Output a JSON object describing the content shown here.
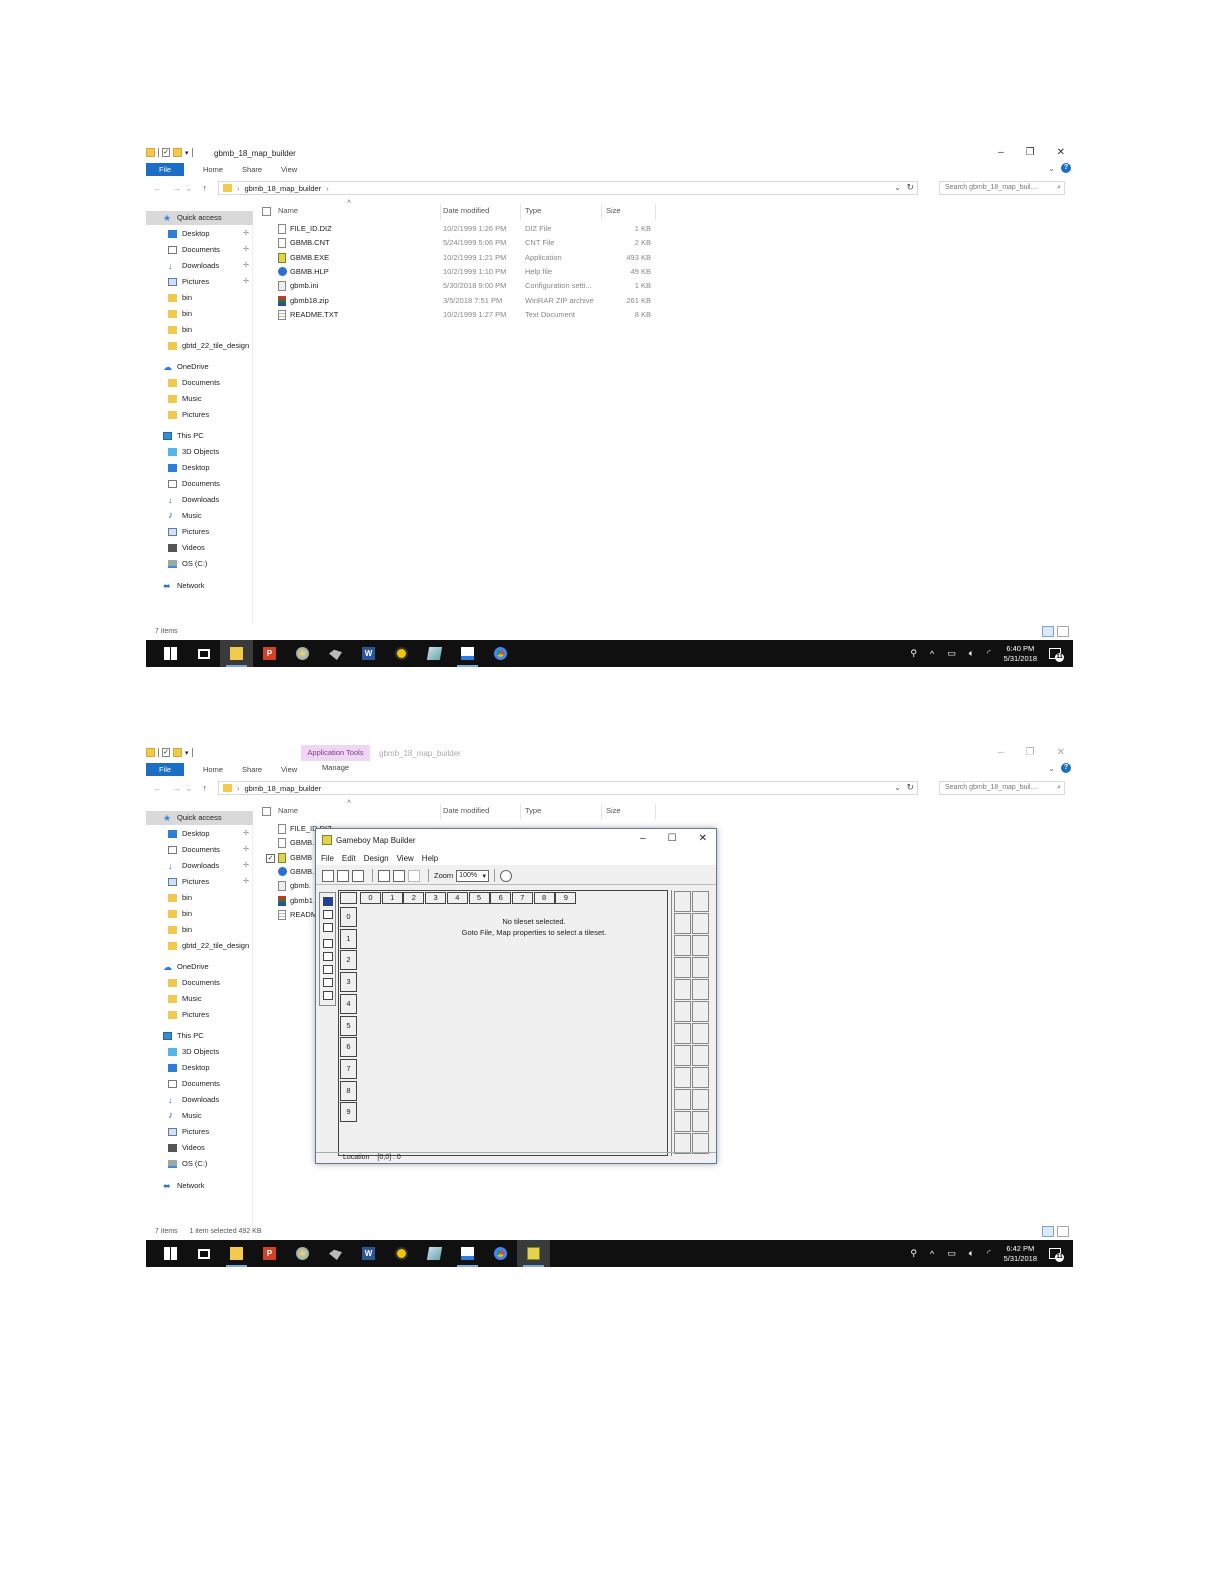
{
  "explorer": {
    "folder_name": "gbmb_18_map_builder",
    "tabs": {
      "file": "File",
      "home": "Home",
      "share": "Share",
      "view": "View"
    },
    "app_tools": {
      "label": "Application Tools",
      "manage": "Manage"
    },
    "search_placeholder": "Search gbmb_18_map_buil...",
    "columns": {
      "name": "Name",
      "date": "Date modified",
      "type": "Type",
      "size": "Size"
    },
    "files": [
      {
        "name": "FILE_ID.DIZ",
        "date": "10/2/1999 1:26 PM",
        "type": "DIZ File",
        "size": "1 KB",
        "icon": "file-icon"
      },
      {
        "name": "GBMB.CNT",
        "date": "5/24/1999 5:06 PM",
        "type": "CNT File",
        "size": "2 KB",
        "icon": "file-icon"
      },
      {
        "name": "GBMB.EXE",
        "date": "10/2/1999 1:21 PM",
        "type": "Application",
        "size": "493 KB",
        "icon": "app-icon"
      },
      {
        "name": "GBMB.HLP",
        "date": "10/2/1999 1:10 PM",
        "type": "Help file",
        "size": "49 KB",
        "icon": "help-icon"
      },
      {
        "name": "gbmb.ini",
        "date": "5/30/2018 9:00 PM",
        "type": "Configuration setti...",
        "size": "1 KB",
        "icon": "config-icon"
      },
      {
        "name": "gbmb18.zip",
        "date": "3/5/2018 7:51 PM",
        "type": "WinRAR ZIP archive",
        "size": "261 KB",
        "icon": "zip-icon"
      },
      {
        "name": "README.TXT",
        "date": "10/2/1999 1:27 PM",
        "type": "Text Document",
        "size": "8 KB",
        "icon": "text-icon"
      }
    ],
    "files_partial": [
      "FILE_ID.DIZ",
      "GBMB.",
      "GBMB",
      "GBMB.",
      "gbmb.",
      "gbmb1",
      "READM"
    ],
    "nav": [
      {
        "label": "Quick access",
        "icon": "star-icon",
        "kind": "header",
        "sel": true
      },
      {
        "label": "Desktop",
        "icon": "desktop-icon",
        "pin": true
      },
      {
        "label": "Documents",
        "icon": "documents-icon",
        "pin": true
      },
      {
        "label": "Downloads",
        "icon": "downloads-icon",
        "pin": true
      },
      {
        "label": "Pictures",
        "icon": "pictures-icon",
        "pin": true
      },
      {
        "label": "bin",
        "icon": "folder-icon"
      },
      {
        "label": "bin",
        "icon": "folder-icon"
      },
      {
        "label": "bin",
        "icon": "folder-icon"
      },
      {
        "label": "gbtd_22_tile_design",
        "icon": "folder-icon"
      },
      {
        "label": "OneDrive",
        "icon": "cloud-icon",
        "kind": "header"
      },
      {
        "label": "Documents",
        "icon": "folder-icon"
      },
      {
        "label": "Music",
        "icon": "folder-icon"
      },
      {
        "label": "Pictures",
        "icon": "folder-icon"
      },
      {
        "label": "This PC",
        "icon": "pc-icon",
        "kind": "header"
      },
      {
        "label": "3D Objects",
        "icon": "cube-icon"
      },
      {
        "label": "Desktop",
        "icon": "desktop-icon"
      },
      {
        "label": "Documents",
        "icon": "documents-icon"
      },
      {
        "label": "Downloads",
        "icon": "downloads-icon"
      },
      {
        "label": "Music",
        "icon": "music-icon"
      },
      {
        "label": "Pictures",
        "icon": "pictures-icon"
      },
      {
        "label": "Videos",
        "icon": "videos-icon"
      },
      {
        "label": "OS (C:)",
        "icon": "drive-icon"
      },
      {
        "label": "Network",
        "icon": "network-icon",
        "kind": "header"
      }
    ],
    "status1": {
      "count": "7 items"
    },
    "status2": {
      "count": "7 items",
      "selected": "1 item selected  492 KB"
    }
  },
  "taskbar": {
    "clock1": {
      "time": "6:40 PM",
      "date": "5/31/2018"
    },
    "clock2": {
      "time": "6:42 PM",
      "date": "5/31/2018"
    },
    "notification_count": "11"
  },
  "gbmb": {
    "title": "Gameboy Map Builder",
    "menu": [
      "File",
      "Edit",
      "Design",
      "View",
      "Help"
    ],
    "zoom_label": "Zoom",
    "zoom_value": "100%",
    "columns": [
      "0",
      "1",
      "2",
      "3",
      "4",
      "5",
      "6",
      "7",
      "8",
      "9"
    ],
    "rows": [
      "0",
      "1",
      "2",
      "3",
      "4",
      "5",
      "6",
      "7",
      "8",
      "9"
    ],
    "message_line1": "No tileset selected.",
    "message_line2": "Goto File, Map properties to select a tileset.",
    "location_label": "Location",
    "location_value": "[0,0] : 0"
  }
}
